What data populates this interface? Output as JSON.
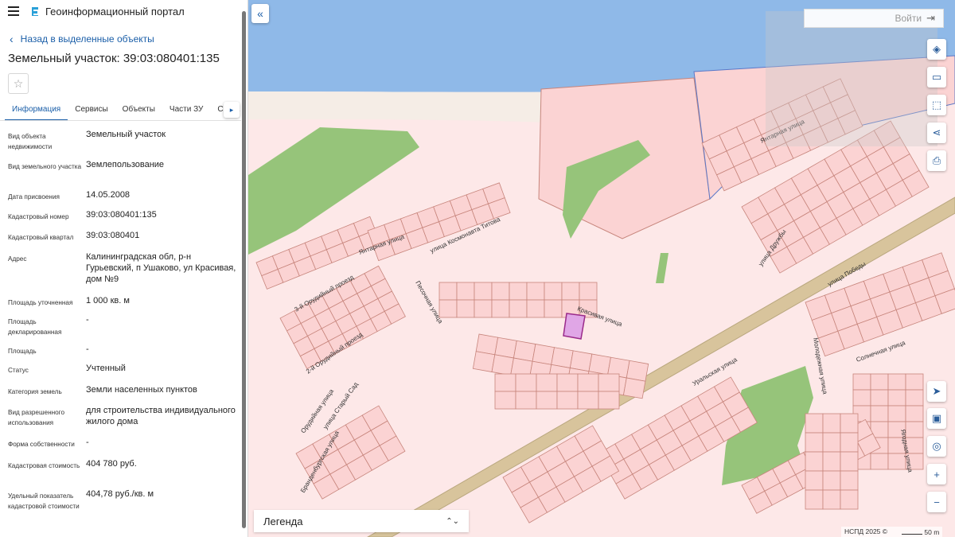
{
  "header": {
    "app_title": "Геоинформационный портал",
    "menu_icon": "hamburger-icon",
    "logo_icon": "portal-logo-icon"
  },
  "back_link": "Назад в выделенные объекты",
  "object_title": "Земельный участок: 39:03:080401:135",
  "favorite_icon": "star-icon",
  "tabs": [
    {
      "label": "Информация",
      "active": true
    },
    {
      "label": "Сервисы"
    },
    {
      "label": "Объекты"
    },
    {
      "label": "Части ЗУ"
    },
    {
      "label": "Соста"
    }
  ],
  "properties": [
    {
      "label": "Вид объекта недвижимости",
      "value": "Земельный участок"
    },
    {
      "label": "Вид земельного участка",
      "value": "Землепользование"
    },
    {
      "label": "Дата присвоения",
      "value": "14.05.2008"
    },
    {
      "label": "Кадастровый номер",
      "value": "39:03:080401:135"
    },
    {
      "label": "Кадастровый квартал",
      "value": "39:03:080401"
    },
    {
      "label": "Адрес",
      "value": "Калининградская обл, р-н Гурьевский, п Ушаково, ул Красивая, дом №9"
    },
    {
      "label": "Площадь уточненная",
      "value": "1 000 кв. м"
    },
    {
      "label": "Площадь декларированная",
      "value": "-"
    },
    {
      "label": "Площадь",
      "value": "-"
    },
    {
      "label": "Статус",
      "value": "Учтенный"
    },
    {
      "label": "Категория земель",
      "value": "Земли населенных пунктов"
    },
    {
      "label": "Вид разрешенного использования",
      "value": "для строительства индивидуального жилого дома"
    },
    {
      "label": "Форма собственности",
      "value": "-"
    },
    {
      "label": "Кадастровая стоимость",
      "value": "404 780 руб."
    },
    {
      "label": "Удельный показатель кадастровой стоимости",
      "value": "404,78 руб./кв. м"
    }
  ],
  "map": {
    "login_label": "Войти",
    "legend_label": "Легенда",
    "attribution": "НСПД 2025 ©",
    "scale_label": "50 m",
    "streets": [
      "Янтарная улица",
      "улица Космонавта Титова",
      "Песочная улица",
      "3-й Орудийный проезд",
      "2-й Орудийный проезд",
      "Орудийная улица",
      "улица Старый Сад",
      "Красивая улица",
      "Уральская улица",
      "Молодежная улица",
      "Солнечная улица",
      "Янтарная улица",
      "улица Дружбы",
      "улица Победы",
      "Янтарная улица",
      "Бранденбургская улица",
      "Ягодная улица"
    ],
    "colors": {
      "water": "#8fb9e8",
      "beach": "#f5ede6",
      "parcel": "#fbd3d3",
      "parcel_border": "#c7857c",
      "green": "#96c47a",
      "selected": "#e0a6e6",
      "road": "#d8c49c"
    }
  }
}
